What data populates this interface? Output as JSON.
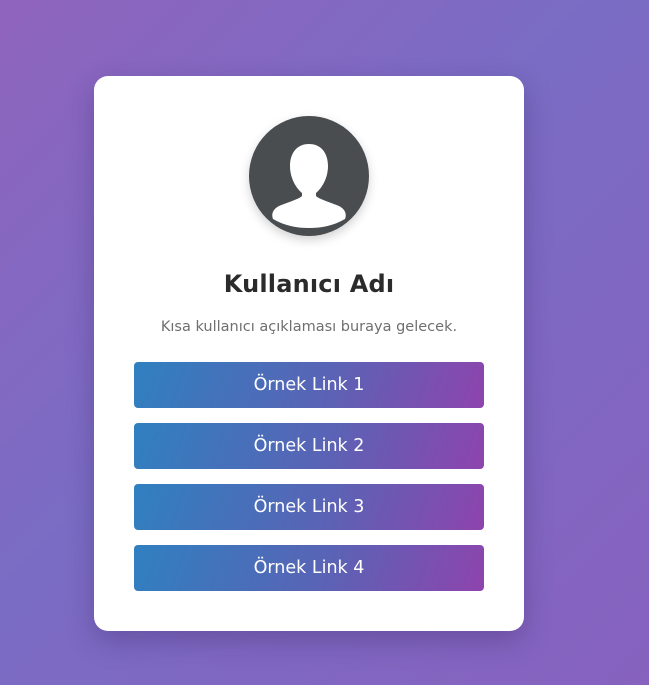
{
  "profile": {
    "avatar_icon": "user-silhouette-icon",
    "name": "Kullanıcı Adı",
    "description": "Kısa kullanıcı açıklaması buraya gelecek."
  },
  "links": [
    {
      "label": "Örnek Link 1"
    },
    {
      "label": "Örnek Link 2"
    },
    {
      "label": "Örnek Link 3"
    },
    {
      "label": "Örnek Link 4"
    }
  ],
  "colors": {
    "background_gradient": [
      "#8f64be",
      "#7a6cc4",
      "#8762bf"
    ],
    "button_gradient": [
      "#2f80c0",
      "#5a63b5",
      "#8e44ad"
    ],
    "avatar_bg": "#4a4d50"
  }
}
